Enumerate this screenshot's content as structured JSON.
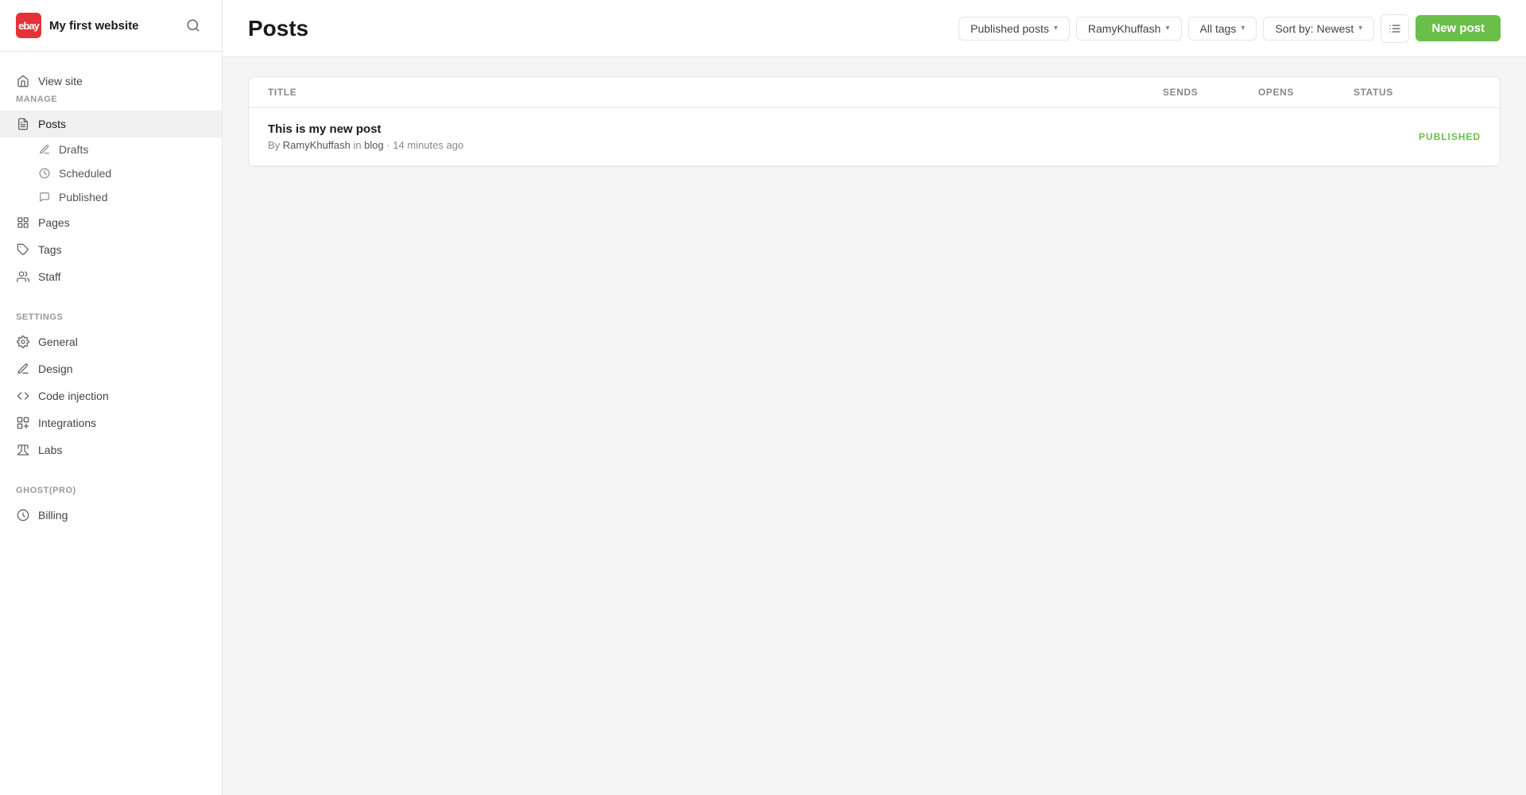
{
  "sidebar": {
    "logo_text": "ebay",
    "site_name": "My first website",
    "view_site_label": "View site",
    "manage_label": "MANAGE",
    "manage_items": [
      {
        "id": "posts",
        "label": "Posts",
        "icon": "posts-icon",
        "active": true
      },
      {
        "id": "pages",
        "label": "Pages",
        "icon": "pages-icon",
        "active": false
      },
      {
        "id": "tags",
        "label": "Tags",
        "icon": "tags-icon",
        "active": false
      },
      {
        "id": "staff",
        "label": "Staff",
        "icon": "staff-icon",
        "active": false
      }
    ],
    "posts_sub_items": [
      {
        "id": "drafts",
        "label": "Drafts",
        "icon": "drafts-icon"
      },
      {
        "id": "scheduled",
        "label": "Scheduled",
        "icon": "scheduled-icon"
      },
      {
        "id": "published",
        "label": "Published",
        "icon": "published-icon"
      }
    ],
    "settings_label": "SETTINGS",
    "settings_items": [
      {
        "id": "general",
        "label": "General",
        "icon": "general-icon"
      },
      {
        "id": "design",
        "label": "Design",
        "icon": "design-icon"
      },
      {
        "id": "code-injection",
        "label": "Code injection",
        "icon": "code-icon"
      },
      {
        "id": "integrations",
        "label": "Integrations",
        "icon": "integrations-icon"
      },
      {
        "id": "labs",
        "label": "Labs",
        "icon": "labs-icon"
      }
    ],
    "ghost_pro_label": "GHOST(PRO)",
    "billing_label": "Billing"
  },
  "header": {
    "title": "Posts",
    "filter_published": "Published posts",
    "filter_author": "RamyKhuffash",
    "filter_tags": "All tags",
    "filter_sort": "Sort by: Newest",
    "new_post_label": "New post"
  },
  "table": {
    "columns": [
      {
        "id": "title",
        "label": "TITLE"
      },
      {
        "id": "sends",
        "label": "SENDS"
      },
      {
        "id": "opens",
        "label": "OPENS"
      },
      {
        "id": "status",
        "label": "STATUS"
      }
    ],
    "rows": [
      {
        "title": "This is my new post",
        "author": "RamyKhuffash",
        "location": "blog",
        "time": "14 minutes ago",
        "sends": "",
        "opens": "",
        "status": "PUBLISHED"
      }
    ]
  }
}
